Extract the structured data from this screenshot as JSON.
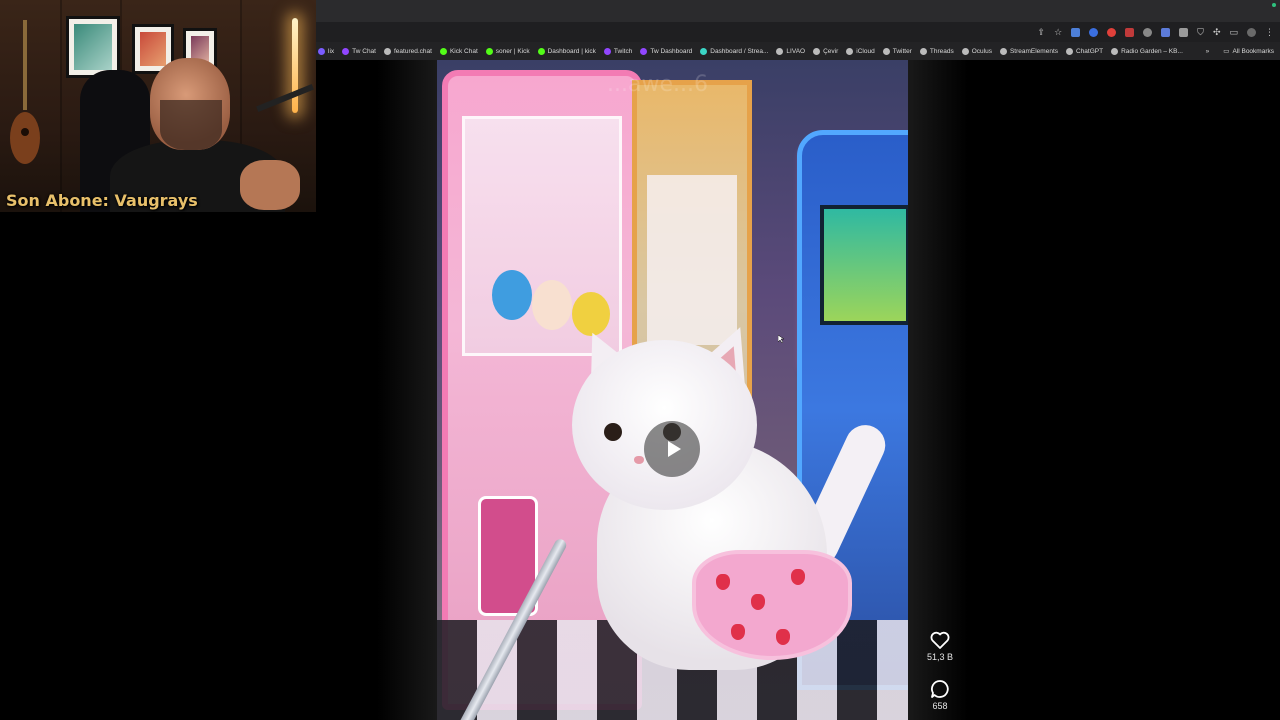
{
  "webcam": {
    "caption": "Son Abone: Vaugrays"
  },
  "browser": {
    "bookmarks": [
      {
        "label": "lix",
        "color": "#7a5cff"
      },
      {
        "label": "Tw Chat",
        "color": "#9146ff"
      },
      {
        "label": "featured.chat",
        "color": "#bbbbbb"
      },
      {
        "label": "Kick Chat",
        "color": "#53fc18"
      },
      {
        "label": "soner | Kick",
        "color": "#53fc18"
      },
      {
        "label": "Dashboard | kick",
        "color": "#53fc18"
      },
      {
        "label": "Twitch",
        "color": "#9146ff"
      },
      {
        "label": "Tw Dashboard",
        "color": "#9146ff"
      },
      {
        "label": "Dashboard / Strea...",
        "color": "#3bd6c6"
      },
      {
        "label": "LIVAO",
        "color": "#bbbbbb"
      },
      {
        "label": "Çevir",
        "color": "#bbbbbb"
      },
      {
        "label": "iCloud",
        "color": "#bbbbbb"
      },
      {
        "label": "Twitter",
        "color": "#bbbbbb"
      },
      {
        "label": "Threads",
        "color": "#bbbbbb"
      },
      {
        "label": "Oculus",
        "color": "#bbbbbb"
      },
      {
        "label": "StreamElements",
        "color": "#bbbbbb"
      },
      {
        "label": "ChatGPT",
        "color": "#bbbbbb"
      },
      {
        "label": "Radio Garden – KB...",
        "color": "#bbbbbb"
      }
    ],
    "more_glyph": "»",
    "all_bookmarks": "All Bookmarks",
    "toolbar_icons": [
      "share-icon",
      "star-icon",
      "extension-icon",
      "extension-icon",
      "extension-icon",
      "extension-icon",
      "extension-icon",
      "extension-icon",
      "extension-icon",
      "shield-icon",
      "puzzle-icon",
      "tab-icon",
      "profile-icon",
      "menu-icon"
    ]
  },
  "video": {
    "watermark": "...awe...6"
  },
  "actions": {
    "likes": "51,3 B",
    "comments": "658"
  }
}
